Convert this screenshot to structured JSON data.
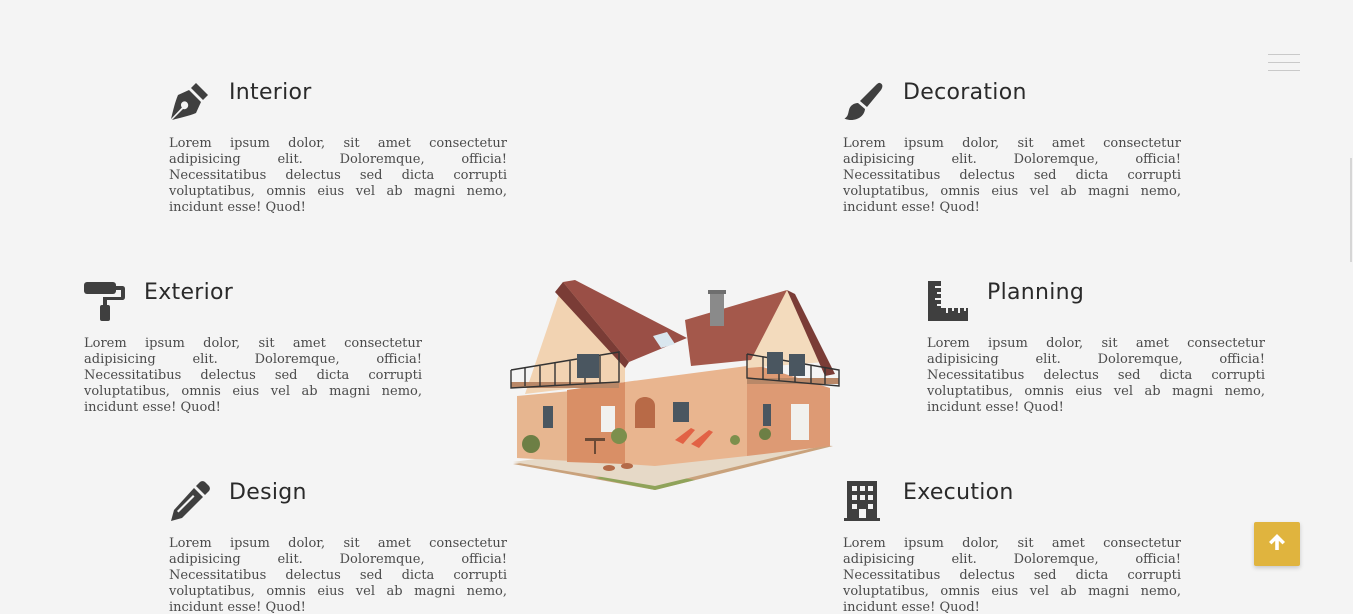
{
  "services": [
    {
      "id": "interior",
      "title": "Interior",
      "icon": "pen-nib-icon",
      "text": "Lorem ipsum dolor, sit amet consectetur adipisicing elit. Doloremque, officia! Necessitatibus delectus sed dicta corrupti voluptatibus, omnis eius vel ab magni nemo, incidunt esse! Quod!"
    },
    {
      "id": "decoration",
      "title": "Decoration",
      "icon": "paint-brush-icon",
      "text": "Lorem ipsum dolor, sit amet consectetur adipisicing elit. Doloremque, officia! Necessitatibus delectus sed dicta corrupti voluptatibus, omnis eius vel ab magni nemo, incidunt esse! Quod!"
    },
    {
      "id": "exterior",
      "title": "Exterior",
      "icon": "paint-roller-icon",
      "text": "Lorem ipsum dolor, sit amet consectetur adipisicing elit. Doloremque, officia! Necessitatibus delectus sed dicta corrupti voluptatibus, omnis eius vel ab magni nemo, incidunt esse! Quod!"
    },
    {
      "id": "planning",
      "title": "Planning",
      "icon": "ruler-combined-icon",
      "text": "Lorem ipsum dolor, sit amet consectetur adipisicing elit. Doloremque, officia! Necessitatibus delectus sed dicta corrupti voluptatibus, omnis eius vel ab magni nemo, incidunt esse! Quod!"
    },
    {
      "id": "design",
      "title": "Design",
      "icon": "pencil-icon",
      "text": "Lorem ipsum dolor, sit amet consectetur adipisicing elit. Doloremque, officia! Necessitatibus delectus sed dicta corrupti voluptatibus, omnis eius vel ab magni nemo, incidunt esse! Quod!"
    },
    {
      "id": "execution",
      "title": "Execution",
      "icon": "building-icon",
      "text": "Lorem ipsum dolor, sit amet consectetur adipisicing elit. Doloremque, officia! Necessitatibus delectus sed dicta corrupti voluptatibus, omnis eius vel ab magni nemo, incidunt esse! Quod!"
    }
  ],
  "nav": {
    "menu_icon": "hamburger-menu-icon"
  },
  "back_to_top": {
    "icon": "arrow-up-icon"
  },
  "hero_image": {
    "subject": "house-image"
  },
  "colors": {
    "background": "#f4f4f4",
    "icon": "#3f3f3f",
    "heading": "#2a2a2a",
    "body_text": "#4a4a4a",
    "accent": "#e0b43e"
  }
}
